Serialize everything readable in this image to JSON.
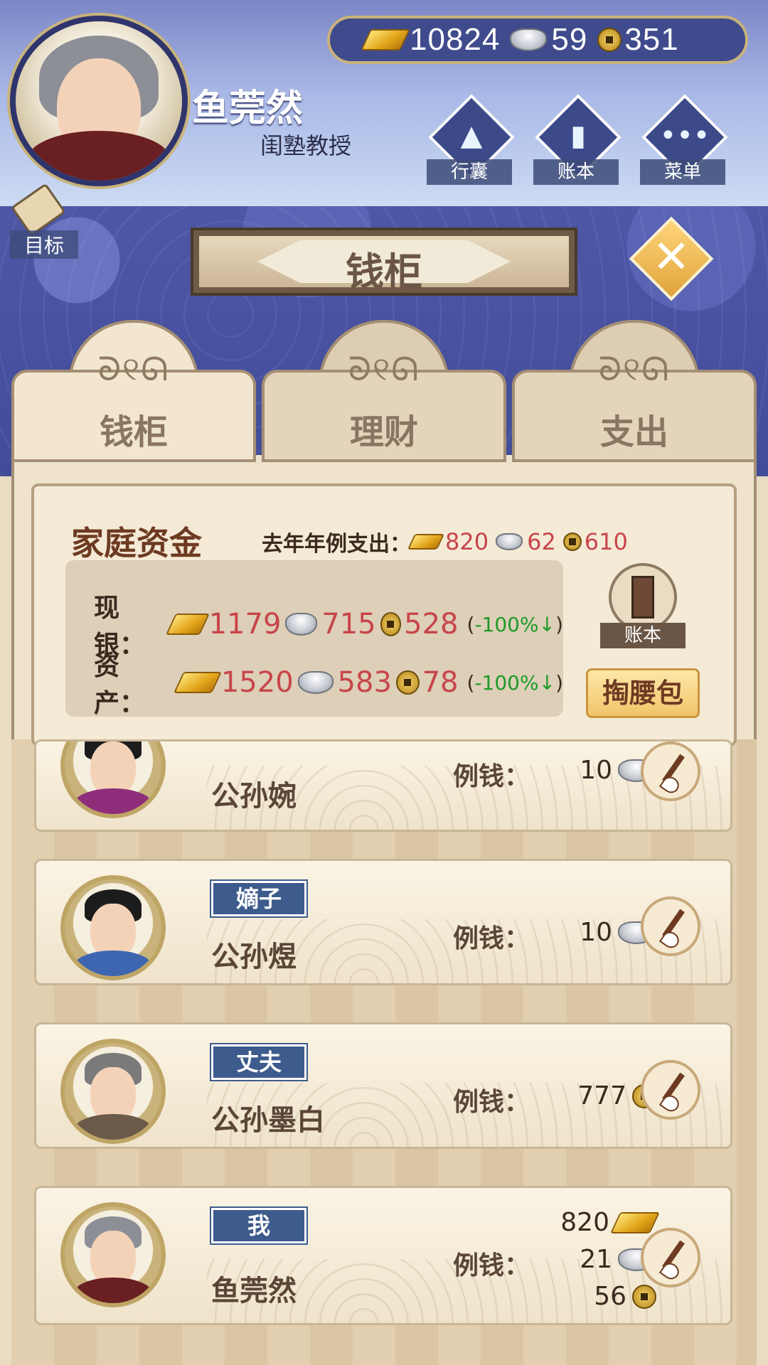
{
  "header": {
    "resources": {
      "gold": "10824",
      "silver": "59",
      "copper": "351"
    },
    "player": {
      "name": "鱼莞然",
      "title": "闺塾教授"
    },
    "buttons": [
      {
        "label": "行囊",
        "icon": "bundle-icon"
      },
      {
        "label": "账本",
        "icon": "ledger-icon"
      },
      {
        "label": "菜单",
        "icon": "menu-dots-icon"
      }
    ],
    "goal_label": "目标"
  },
  "panel": {
    "title": "钱柜",
    "tabs": [
      {
        "label": "钱柜",
        "active": true
      },
      {
        "label": "理财",
        "active": false
      },
      {
        "label": "支出",
        "active": false
      }
    ],
    "swirl": "ᘐ୧ᘏ"
  },
  "fund": {
    "title": "家庭资金",
    "last_year_label": "去年年例支出：",
    "last_year": {
      "gold": "820",
      "silver": "62",
      "copper": "610"
    },
    "cash": {
      "label": "现银：",
      "gold": "1179",
      "silver": "715",
      "copper": "528",
      "pct": "-100%",
      "arrow": "↓"
    },
    "assets": {
      "label": "资产：",
      "gold": "1520",
      "silver": "583",
      "copper": "78",
      "pct": "-100%",
      "arrow": "↓"
    },
    "ledger_label": "账本",
    "purse_label": "掏腰包"
  },
  "members": [
    {
      "role": "",
      "name": "公孙婉",
      "allowance_label": "例钱：",
      "allowance": [
        "10"
      ],
      "currency": [
        "silver"
      ],
      "robe": "#8e2e7a",
      "hair": "#1c1c1c"
    },
    {
      "role": "嫡子",
      "name": "公孙煜",
      "allowance_label": "例钱：",
      "allowance": [
        "10"
      ],
      "currency": [
        "silver"
      ],
      "robe": "#3e66b0",
      "hair": "#1c1c1c"
    },
    {
      "role": "丈夫",
      "name": "公孙墨白",
      "allowance_label": "例钱：",
      "allowance": [
        "777"
      ],
      "currency": [
        "copper"
      ],
      "robe": "#6b5a4a",
      "hair": "#7a7a7a"
    },
    {
      "role": "我",
      "name": "鱼莞然",
      "allowance_label": "例钱：",
      "allowance": [
        "820",
        "21",
        "56"
      ],
      "currency": [
        "gold",
        "silver",
        "copper"
      ],
      "robe": "#6a1f22",
      "hair": "#8d8f97"
    }
  ],
  "colors": {
    "accent_red": "#c8454a",
    "role_badge": "#3d5b8c",
    "down_green": "#1f9a2a",
    "title_blue": "#3f4b8c"
  }
}
